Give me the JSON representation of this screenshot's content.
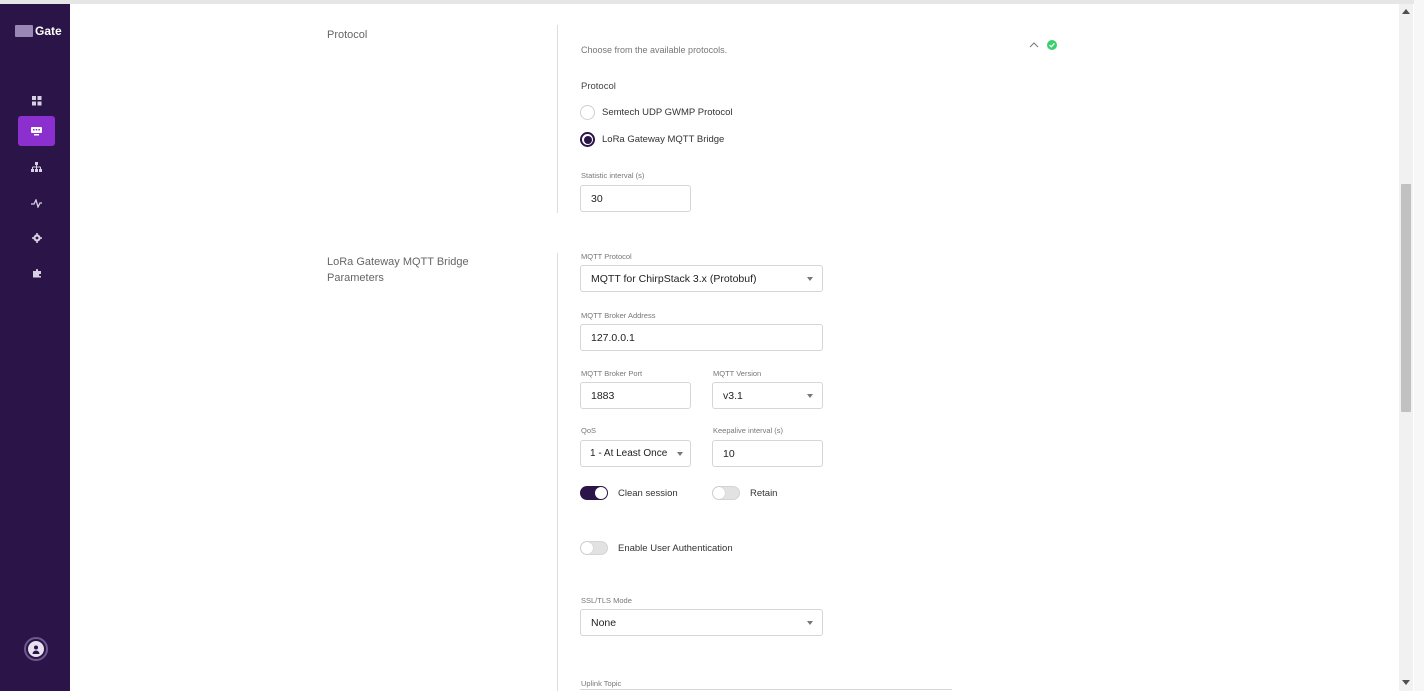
{
  "app": {
    "logo_text": "Gate"
  },
  "sidebar": {
    "items": [
      {
        "name": "dashboard-icon"
      },
      {
        "name": "gateway-icon",
        "active": true
      },
      {
        "name": "network-icon"
      },
      {
        "name": "activity-icon"
      },
      {
        "name": "settings-icon"
      },
      {
        "name": "extensions-icon"
      }
    ]
  },
  "protocol_section": {
    "label": "Protocol",
    "description": "Choose from the available protocols.",
    "subheading": "Protocol",
    "options": [
      "Semtech UDP GWMP Protocol",
      "LoRa Gateway MQTT Bridge"
    ],
    "selected_index": 1,
    "statistic_interval_label": "Statistic interval (s)",
    "statistic_interval_value": "30",
    "status": "valid"
  },
  "mqtt_section": {
    "label_line1": "LoRa Gateway MQTT Bridge",
    "label_line2": "Parameters",
    "protocol_label": "MQTT Protocol",
    "protocol_value": "MQTT for ChirpStack 3.x (Protobuf)",
    "broker_address_label": "MQTT Broker Address",
    "broker_address_value": "127.0.0.1",
    "broker_port_label": "MQTT Broker Port",
    "broker_port_value": "1883",
    "version_label": "MQTT Version",
    "version_value": "v3.1",
    "qos_label": "QoS",
    "qos_value": "1 - At Least Once",
    "keepalive_label": "Keepalive interval (s)",
    "keepalive_value": "10",
    "clean_session_label": "Clean session",
    "clean_session_on": true,
    "retain_label": "Retain",
    "retain_on": false,
    "user_auth_label": "Enable User Authentication",
    "user_auth_on": false,
    "ssl_mode_label": "SSL/TLS Mode",
    "ssl_mode_value": "None",
    "uplink_topic_label": "Uplink Topic"
  },
  "colors": {
    "sidebar": "#2b1448",
    "accent": "#8b2fcf",
    "success": "#3ccf6e"
  }
}
